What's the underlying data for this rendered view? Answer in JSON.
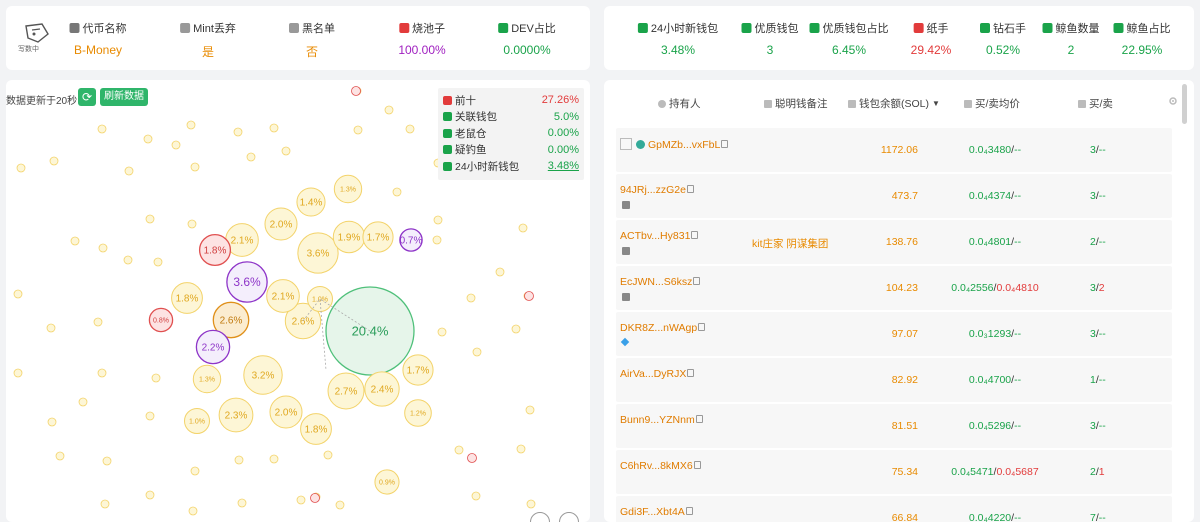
{
  "token_stats": [
    {
      "label": "代币名称",
      "value": "B-Money",
      "color": "#e88a00",
      "icon": "coin-stack-icon"
    },
    {
      "label": "Mint丢弃",
      "value": "是",
      "color": "#e88a00",
      "icon": "person-icon"
    },
    {
      "label": "黑名单",
      "value": "否",
      "color": "#e88a00",
      "icon": "person-icon"
    },
    {
      "label": "烧池子",
      "value": "100.00%",
      "color": "#a020c0",
      "icon": "fire-icon"
    },
    {
      "label": "DEV占比",
      "value": "0.0000%",
      "color": "#1aa34a",
      "icon": "dev-icon"
    }
  ],
  "logo_text": "写数中",
  "wallet_stats": [
    {
      "label": "24小时新钱包",
      "value": "3.48%",
      "color": "#1aa34a",
      "icon": "new-wallet-icon"
    },
    {
      "label": "优质钱包",
      "value": "3",
      "color": "#1aa34a",
      "icon": "quality-wallet-icon"
    },
    {
      "label": "优质钱包占比",
      "value": "6.45%",
      "color": "#1aa34a",
      "icon": "quality-ratio-icon"
    },
    {
      "label": "纸手",
      "value": "29.42%",
      "color": "#e23b3b",
      "icon": "paper-hand-icon"
    },
    {
      "label": "钻石手",
      "value": "0.52%",
      "color": "#1aa34a",
      "icon": "diamond-icon"
    },
    {
      "label": "鲸鱼数量",
      "value": "2",
      "color": "#1aa34a",
      "icon": "whale-icon"
    },
    {
      "label": "鲸鱼占比",
      "value": "22.95%",
      "color": "#1aa34a",
      "icon": "whale-icon"
    }
  ],
  "bubble_panel": {
    "update_text": "数据更新于20秒",
    "refresh_label": "刷新数据",
    "legend": [
      {
        "label": "前十",
        "value": "27.26%",
        "color": "#e23b3b",
        "icon": "top-ten-icon",
        "underline": false
      },
      {
        "label": "关联钱包",
        "value": "5.0%",
        "color": "#1aa34a",
        "icon": "link-icon",
        "underline": false
      },
      {
        "label": "老鼠仓",
        "value": "0.00%",
        "color": "#1aa34a",
        "icon": "rat-icon",
        "underline": false
      },
      {
        "label": "疑钓鱼",
        "value": "0.00%",
        "color": "#1aa34a",
        "icon": "fishing-icon",
        "underline": false
      },
      {
        "label": "24小时新钱包",
        "value": "3.48%",
        "color": "#1aa34a",
        "icon": "new-wallet-icon",
        "underline": true
      }
    ],
    "bubbles": [
      {
        "label": "20.4%",
        "kind": "green",
        "value": 20.4
      },
      {
        "label": "3.6%",
        "kind": "purple-big",
        "value": 3.6
      },
      {
        "label": "3.6%",
        "kind": "yellow",
        "value": 3.6
      },
      {
        "label": "3.2%",
        "kind": "yellow",
        "value": 3.2
      },
      {
        "label": "2.7%",
        "kind": "yellow",
        "value": 2.7
      },
      {
        "label": "2.6%",
        "kind": "orange",
        "value": 2.6
      },
      {
        "label": "2.6%",
        "kind": "yellow",
        "value": 2.6
      },
      {
        "label": "2.4%",
        "kind": "yellow",
        "value": 2.4
      },
      {
        "label": "2.3%",
        "kind": "yellow",
        "value": 2.3
      },
      {
        "label": "2.2%",
        "kind": "purple",
        "value": 2.2
      },
      {
        "label": "2.1%",
        "kind": "yellow",
        "value": 2.1
      },
      {
        "label": "2.1%",
        "kind": "yellow",
        "value": 2.1
      },
      {
        "label": "2.0%",
        "kind": "yellow",
        "value": 2.0
      },
      {
        "label": "2.0%",
        "kind": "yellow",
        "value": 2.0
      },
      {
        "label": "1.9%",
        "kind": "yellow",
        "value": 1.9
      },
      {
        "label": "1.8%",
        "kind": "red",
        "value": 1.8
      },
      {
        "label": "1.8%",
        "kind": "yellow",
        "value": 1.8
      },
      {
        "label": "1.8%",
        "kind": "yellow",
        "value": 1.8
      },
      {
        "label": "1.7%",
        "kind": "yellow",
        "value": 1.7
      },
      {
        "label": "1.7%",
        "kind": "yellow",
        "value": 1.7
      },
      {
        "label": "1.4%",
        "kind": "yellow",
        "value": 1.4
      },
      {
        "label": "1.3%",
        "kind": "yellow",
        "value": 1.3
      },
      {
        "label": "1.3%",
        "kind": "yellow",
        "value": 1.3
      },
      {
        "label": "1.2%",
        "kind": "yellow",
        "value": 1.2
      },
      {
        "label": "1.0%",
        "kind": "yellow",
        "value": 1.0
      },
      {
        "label": "1.0%",
        "kind": "yellow",
        "value": 1.0
      },
      {
        "label": "0.9%",
        "kind": "yellow",
        "value": 0.9
      },
      {
        "label": "0.8%",
        "kind": "red",
        "value": 0.8
      },
      {
        "label": "0.7%",
        "kind": "purple",
        "value": 0.7
      }
    ]
  },
  "table": {
    "headers": [
      {
        "label": "持有人",
        "icon": "person-icon"
      },
      {
        "label": "聪明钱备注",
        "icon": "note-icon"
      },
      {
        "label": "钱包余额(SOL)",
        "icon": "wallet-icon"
      },
      {
        "label": "买/卖均价",
        "icon": "price-icon"
      },
      {
        "label": "买/卖",
        "icon": "trade-icon"
      }
    ],
    "rows": [
      {
        "holder": "GpMZb...vxFbL",
        "note": "",
        "balance": "1172.06",
        "buy_price": "0.0₄3480",
        "sell_price": "--",
        "buys": "3",
        "sells": "--",
        "sub_icon": "avatar"
      },
      {
        "holder": "94JRj...zzG2e",
        "note": "",
        "balance": "473.7",
        "buy_price": "0.0₄4374",
        "sell_price": "--",
        "buys": "3",
        "sells": "--",
        "sub_icon": "tag"
      },
      {
        "holder": "ACTbv...Hy831",
        "note": "kit庄家 阴谋集团",
        "balance": "138.76",
        "buy_price": "0.0₄4801",
        "sell_price": "--",
        "buys": "2",
        "sells": "--",
        "sub_icon": "tag"
      },
      {
        "holder": "EcJWN...S6ksz",
        "note": "",
        "balance": "104.23",
        "buy_price": "0.0₄2556",
        "sell_price": "0.0₄4810",
        "buys": "3",
        "sells": "2",
        "sub_icon": "tag"
      },
      {
        "holder": "DKR8Z...nWAgp",
        "note": "",
        "balance": "97.07",
        "buy_price": "0.0₃1293",
        "sell_price": "--",
        "buys": "3",
        "sells": "--",
        "sub_icon": "diamond"
      },
      {
        "holder": "AirVa...DyRJX",
        "note": "",
        "balance": "82.92",
        "buy_price": "0.0₄4700",
        "sell_price": "--",
        "buys": "1",
        "sells": "--",
        "sub_icon": "none"
      },
      {
        "holder": "Bunn9...YZNnm",
        "note": "",
        "balance": "81.51",
        "buy_price": "0.0₄5296",
        "sell_price": "--",
        "buys": "3",
        "sells": "--",
        "sub_icon": "none"
      },
      {
        "holder": "C6hRv...8kMX6",
        "note": "",
        "balance": "75.34",
        "buy_price": "0.0₄5471",
        "sell_price": "0.0₄5687",
        "buys": "2",
        "sells": "1",
        "sub_icon": "none"
      },
      {
        "holder": "Gdi3F...Xbt4A",
        "note": "",
        "balance": "66.84",
        "buy_price": "0.0₄4220",
        "sell_price": "--",
        "buys": "7",
        "sells": "--",
        "sub_icon": "none"
      }
    ]
  }
}
